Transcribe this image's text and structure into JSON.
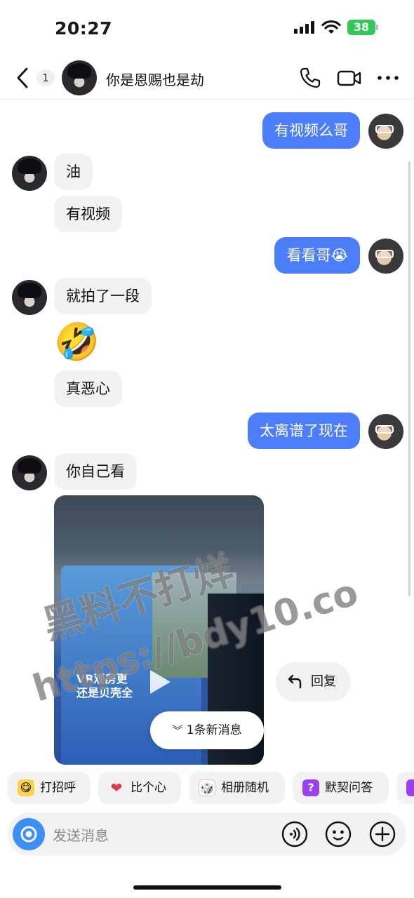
{
  "status": {
    "time": "20:27",
    "battery": "38"
  },
  "header": {
    "unread_count": "1",
    "title": "你是恩赐也是劫"
  },
  "messages": {
    "m1": "有视频么哥",
    "m2": "油",
    "m3": "有视频",
    "m4": "看看哥😭",
    "m5": "就拍了一段",
    "m6": "🤣",
    "m7": "真恶心",
    "m8": "太离谱了现在",
    "m9": "你自己看"
  },
  "video": {
    "overlay_text_1": "VR观房更",
    "overlay_text_2": "还是贝壳全"
  },
  "watermark": {
    "line1": "黑料不打烊",
    "line2": "https://bdy10.co"
  },
  "reply_label": "回复",
  "new_message_label": "1条新消息",
  "chips": [
    {
      "label": "打招呼",
      "icon": "😋"
    },
    {
      "label": "比个心",
      "icon": "❤"
    },
    {
      "label": "相册随机",
      "icon": "🎲"
    },
    {
      "label": "默契问答",
      "icon": "?"
    }
  ],
  "input": {
    "placeholder": "发送消息"
  },
  "colors": {
    "outgoing": "#4c7dfb",
    "incoming": "#f2f2f2",
    "camera": "#3b8ff5",
    "battery": "#34c759"
  }
}
